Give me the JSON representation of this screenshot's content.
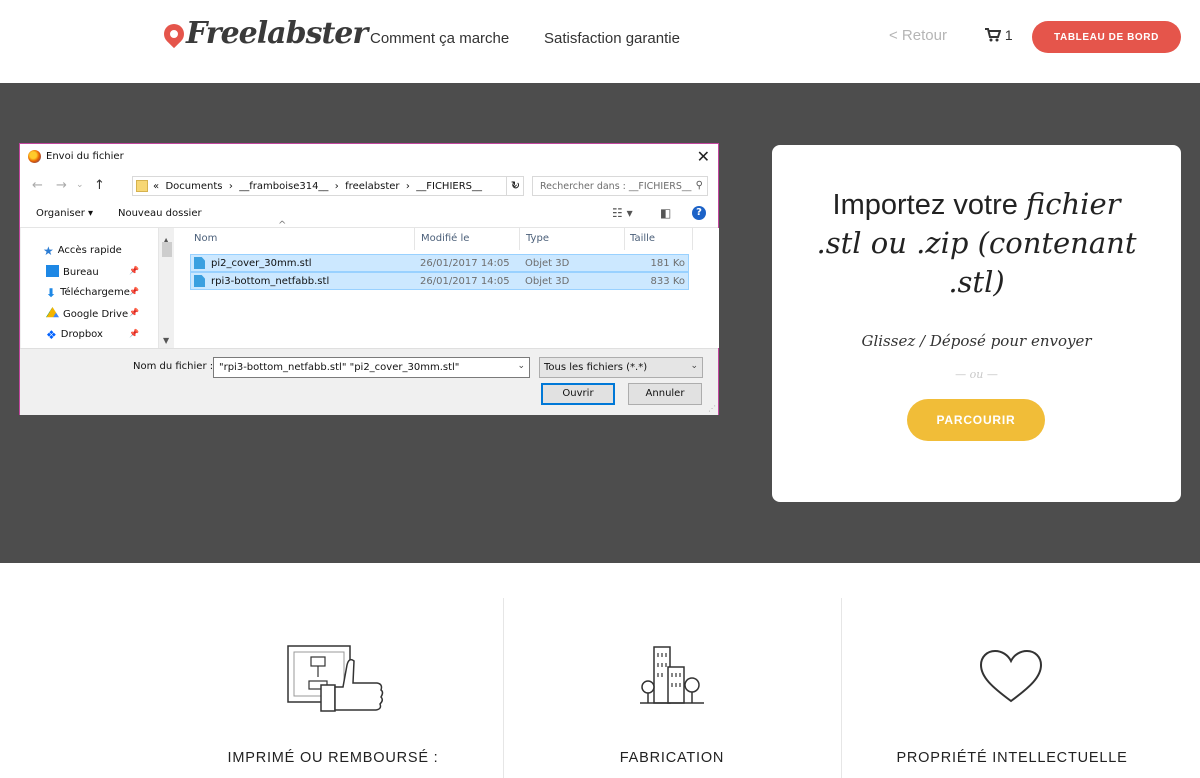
{
  "header": {
    "logo_text": "Freelabster",
    "nav": [
      "Comment ça marche",
      "Satisfaction garantie"
    ],
    "back_link": "< Retour",
    "cart_count": "1",
    "dashboard_button": "TABLEAU DE BORD"
  },
  "dialog": {
    "title": "Envoi du fichier",
    "close": "✕",
    "breadcrumb_prefix": "«",
    "breadcrumb": [
      "Documents",
      "__framboise314__",
      "freelabster",
      "__FICHIERS__"
    ],
    "search_placeholder": "Rechercher dans : __FICHIERS__",
    "organize": "Organiser ▾",
    "new_folder": "Nouveau dossier",
    "sidebar": [
      {
        "label": "Accès rapide",
        "icon": "star-icon"
      },
      {
        "label": "Bureau",
        "icon": "desktop-icon"
      },
      {
        "label": "Téléchargeme",
        "icon": "download-icon"
      },
      {
        "label": "Google Drive",
        "icon": "google-drive-icon"
      },
      {
        "label": "Dropbox",
        "icon": "dropbox-icon"
      }
    ],
    "columns": [
      "Nom",
      "Modifié le",
      "Type",
      "Taille"
    ],
    "files": [
      {
        "name": "pi2_cover_30mm.stl",
        "modified": "26/01/2017 14:05",
        "type": "Objet 3D",
        "size": "181 Ko"
      },
      {
        "name": "rpi3-bottom_netfabb.stl",
        "modified": "26/01/2017 14:05",
        "type": "Objet 3D",
        "size": "833 Ko"
      }
    ],
    "filename_label": "Nom du fichier :",
    "filename_value": "\"rpi3-bottom_netfabb.stl\" \"pi2_cover_30mm.stl\"",
    "filter_value": "Tous les fichiers (*.*)",
    "open_button": "Ouvrir",
    "cancel_button": "Annuler"
  },
  "upload_card": {
    "title_plain_1": "Importez votre ",
    "title_italic_1": "fichier",
    "title_italic_2": ".stl ou .zip (contenant",
    "title_italic_3": ".stl)",
    "drop_text": "Glissez / Déposé pour envoyer",
    "or_text": "— ou —",
    "browse_button": "PARCOURIR"
  },
  "features": [
    {
      "title": "IMPRIMÉ OU REMBOURSÉ :",
      "icon": "printer-thumbs-up-icon"
    },
    {
      "title": "FABRICATION",
      "icon": "city-buildings-icon"
    },
    {
      "title": "PROPRIÉTÉ INTELLECTUELLE",
      "icon": "heart-icon"
    }
  ],
  "colors": {
    "accent_red": "#e5554b",
    "accent_yellow": "#f1bd38",
    "hero_bg": "#4d4d4d"
  }
}
